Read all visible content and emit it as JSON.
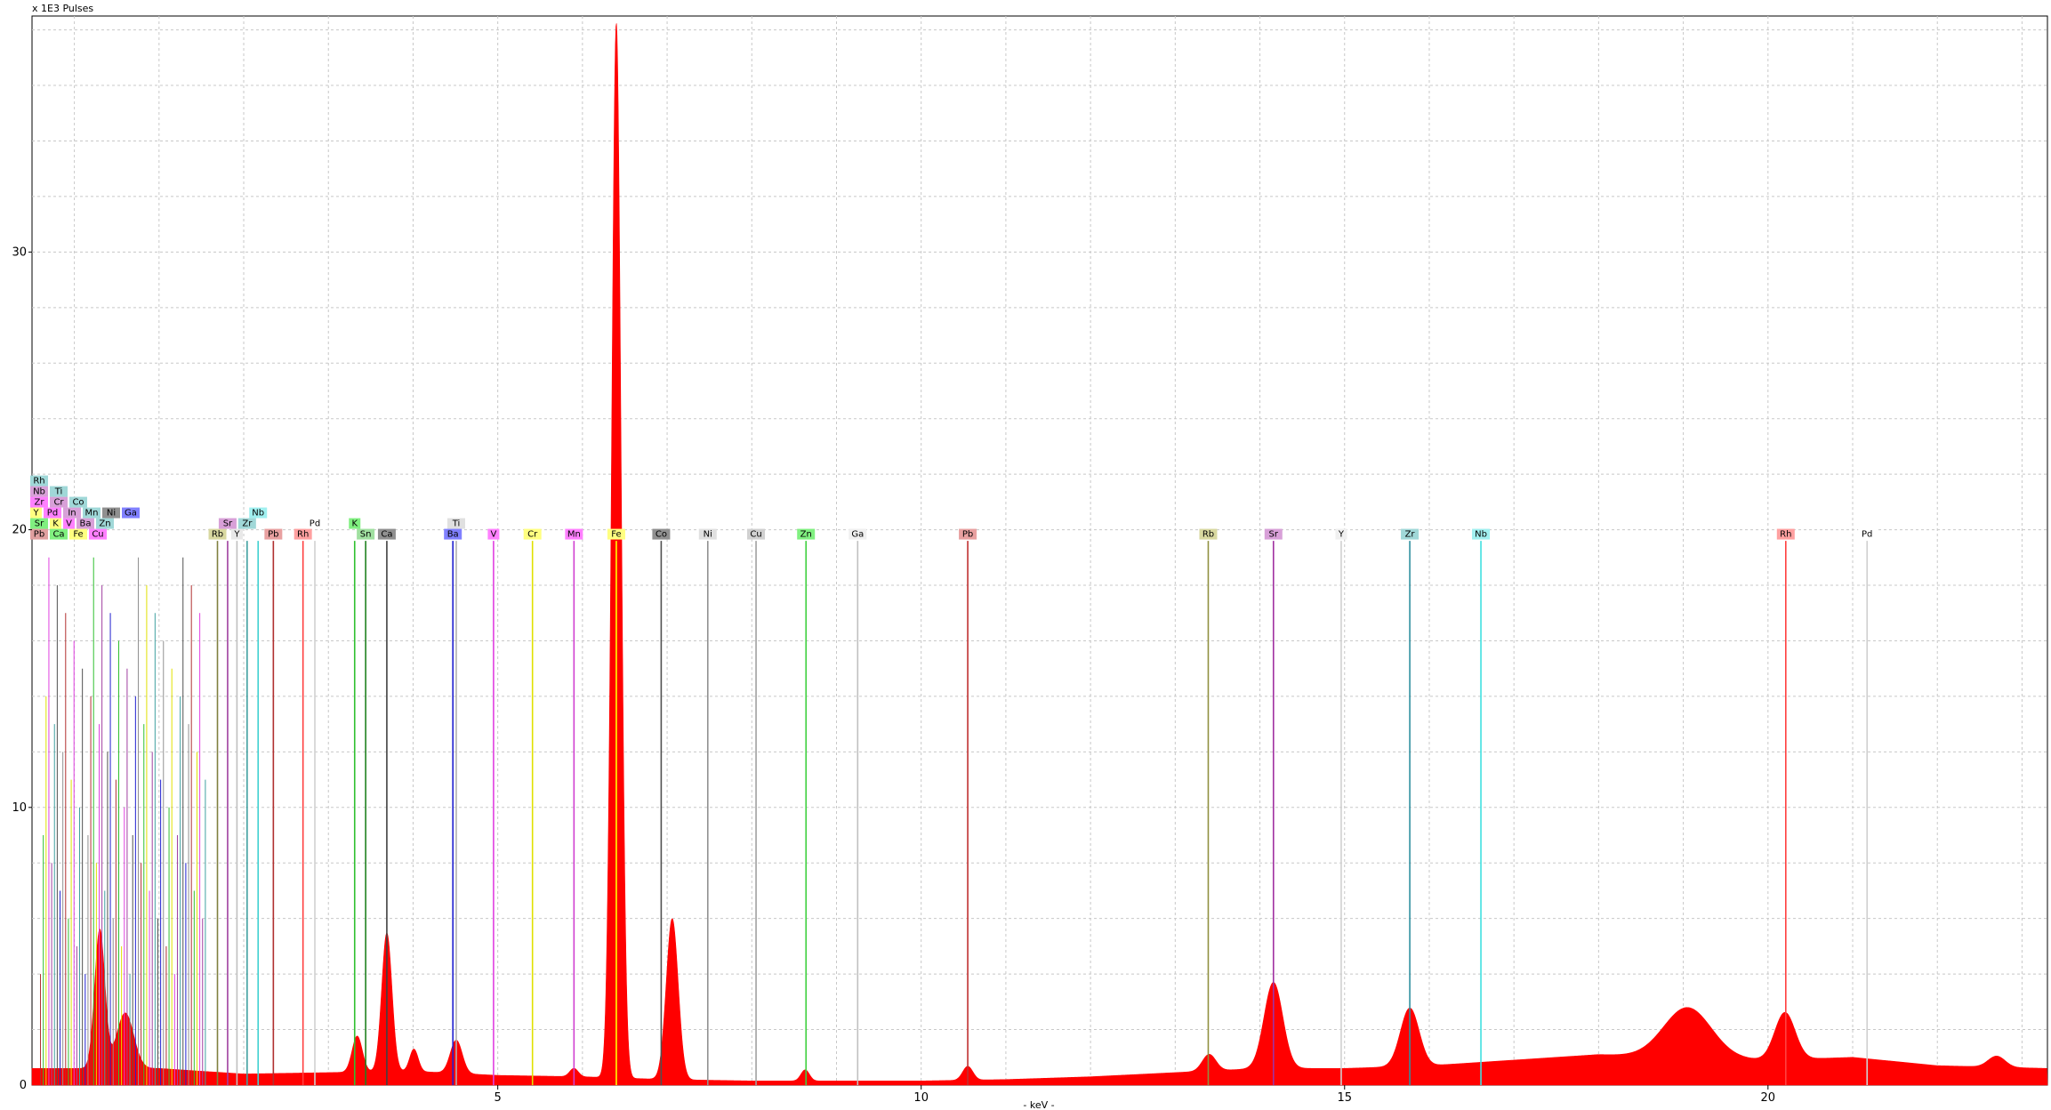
{
  "chart_data": {
    "type": "line",
    "title": "",
    "ylabel": "x 1E3 Pulses",
    "xlabel": "- keV -",
    "xlim": [
      -0.5,
      23.3
    ],
    "ylim": [
      0,
      38.5
    ],
    "x_ticks": [
      5,
      10,
      15,
      20
    ],
    "y_ticks": [
      10,
      20,
      30
    ],
    "grid": true,
    "spectrum": {
      "color": "#ff0000",
      "background": [
        [
          -0.4,
          0.6
        ],
        [
          1,
          0.6
        ],
        [
          2,
          0.4
        ],
        [
          3,
          0.45
        ],
        [
          4,
          0.5
        ],
        [
          5,
          0.35
        ],
        [
          6,
          0.3
        ],
        [
          7,
          0.2
        ],
        [
          8,
          0.15
        ],
        [
          9,
          0.15
        ],
        [
          10,
          0.15
        ],
        [
          11,
          0.2
        ],
        [
          12,
          0.3
        ],
        [
          13,
          0.45
        ],
        [
          14,
          0.6
        ],
        [
          15,
          0.6
        ],
        [
          16,
          0.7
        ],
        [
          17,
          0.9
        ],
        [
          18,
          1.1
        ],
        [
          19,
          1.0
        ],
        [
          20,
          0.9
        ],
        [
          21,
          1.0
        ],
        [
          22,
          0.7
        ],
        [
          23.3,
          0.6
        ]
      ],
      "peaks": [
        {
          "x": 6.4,
          "h": 38.0,
          "w": 0.055
        },
        {
          "x": 7.06,
          "h": 5.8,
          "w": 0.07
        },
        {
          "x": 3.69,
          "h": 5.0,
          "w": 0.06
        },
        {
          "x": 3.34,
          "h": 1.3,
          "w": 0.06
        },
        {
          "x": 4.01,
          "h": 0.8,
          "w": 0.05
        },
        {
          "x": 4.51,
          "h": 1.2,
          "w": 0.07
        },
        {
          "x": 5.9,
          "h": 0.3,
          "w": 0.05
        },
        {
          "x": 8.63,
          "h": 0.4,
          "w": 0.05
        },
        {
          "x": 10.55,
          "h": 0.5,
          "w": 0.06
        },
        {
          "x": 13.4,
          "h": 0.6,
          "w": 0.08
        },
        {
          "x": 14.16,
          "h": 3.1,
          "w": 0.11
        },
        {
          "x": 15.77,
          "h": 2.1,
          "w": 0.11
        },
        {
          "x": 19.05,
          "h": 1.8,
          "w": 0.28
        },
        {
          "x": 20.2,
          "h": 1.7,
          "w": 0.12
        },
        {
          "x": 22.7,
          "h": 0.4,
          "w": 0.1
        },
        {
          "x": 0.3,
          "h": 5.0,
          "w": 0.06
        },
        {
          "x": 0.6,
          "h": 2.0,
          "w": 0.1
        }
      ]
    },
    "element_markers": [
      {
        "label": "Rb",
        "x": 1.69,
        "color": "#d8d8a0",
        "line": "#808040",
        "row": 0
      },
      {
        "label": "Y",
        "x": 1.92,
        "color": "#e8e8e8",
        "line": "#c0c0c0",
        "row": 0
      },
      {
        "label": "Sr",
        "x": 1.81,
        "color": "#d8a0d8",
        "line": "#a040a0",
        "row": 1
      },
      {
        "label": "Zr",
        "x": 2.04,
        "color": "#a0d8d8",
        "line": "#40a0a0",
        "row": 1
      },
      {
        "label": "Nb",
        "x": 2.17,
        "color": "#a0f0f0",
        "line": "#40d0d0",
        "row": 2
      },
      {
        "label": "Pb",
        "x": 2.35,
        "color": "#e8a0a0",
        "line": "#b03030",
        "row": 0
      },
      {
        "label": "Rh",
        "x": 2.7,
        "color": "#ffa0a0",
        "line": "#ff4040",
        "row": 0
      },
      {
        "label": "Pd",
        "x": 2.84,
        "color": "#ffffff",
        "line": "#d0d0d0",
        "row": 1
      },
      {
        "label": "K",
        "x": 3.31,
        "color": "#80f080",
        "line": "#30c030",
        "row": 1
      },
      {
        "label": "Sn",
        "x": 3.44,
        "color": "#a0e0a0",
        "line": "#208020",
        "row": 0
      },
      {
        "label": "Ca",
        "x": 3.69,
        "color": "#909090",
        "line": "#404040",
        "row": 0
      },
      {
        "label": "Ti",
        "x": 4.51,
        "color": "#e0e0e0",
        "line": "#b0b0b0",
        "row": 1
      },
      {
        "label": "Ba",
        "x": 4.47,
        "color": "#8080ff",
        "line": "#2020d0",
        "row": 0
      },
      {
        "label": "V",
        "x": 4.95,
        "color": "#ff80ff",
        "line": "#e040e0",
        "row": 0
      },
      {
        "label": "Cr",
        "x": 5.41,
        "color": "#ffff80",
        "line": "#e0e000",
        "row": 0
      },
      {
        "label": "Mn",
        "x": 5.9,
        "color": "#ff80ff",
        "line": "#d040d0",
        "row": 0
      },
      {
        "label": "Fe",
        "x": 6.4,
        "color": "#ffff80",
        "line": "#ffff00",
        "row": 0
      },
      {
        "label": "Co",
        "x": 6.93,
        "color": "#909090",
        "line": "#505050",
        "row": 0
      },
      {
        "label": "Ni",
        "x": 7.48,
        "color": "#e0e0e0",
        "line": "#909090",
        "row": 0
      },
      {
        "label": "Cu",
        "x": 8.05,
        "color": "#d0d0d0",
        "line": "#a0a0a0",
        "row": 0
      },
      {
        "label": "Zn",
        "x": 8.64,
        "color": "#80f080",
        "line": "#40d040",
        "row": 0
      },
      {
        "label": "Ga",
        "x": 9.25,
        "color": "#f0f0f0",
        "line": "#c0c0c0",
        "row": 0
      },
      {
        "label": "Pb",
        "x": 10.55,
        "color": "#e8a0a0",
        "line": "#c03030",
        "row": 0
      },
      {
        "label": "Rb",
        "x": 13.39,
        "color": "#d8d8a0",
        "line": "#909040",
        "row": 0
      },
      {
        "label": "Sr",
        "x": 14.16,
        "color": "#d8a0d8",
        "line": "#a030a0",
        "row": 0
      },
      {
        "label": "Y",
        "x": 14.96,
        "color": "#f0f0f0",
        "line": "#d0d0d0",
        "row": 0
      },
      {
        "label": "Zr",
        "x": 15.77,
        "color": "#a0d8d8",
        "line": "#3090a0",
        "row": 0
      },
      {
        "label": "Nb",
        "x": 16.61,
        "color": "#a0f0f0",
        "line": "#40e0e0",
        "row": 0
      },
      {
        "label": "Rh",
        "x": 20.21,
        "color": "#ffa0a0",
        "line": "#ff4040",
        "row": 0
      },
      {
        "label": "Pd",
        "x": 21.17,
        "color": "#ffffff",
        "line": "#d0d0d0",
        "row": 0
      }
    ],
    "low_energy_cluster": {
      "rows": [
        [
          "Pb",
          "Ca",
          "Fe",
          "Cu"
        ],
        [
          "Sr",
          "K",
          "V",
          "Ba",
          "Zn"
        ],
        [
          "Y",
          "Pd",
          "In",
          "Mn",
          "Ni",
          "Ga"
        ],
        [
          "Zr",
          "Cr",
          "Co"
        ],
        [
          "Nb",
          "Ti"
        ],
        [
          "Rh"
        ]
      ]
    }
  }
}
